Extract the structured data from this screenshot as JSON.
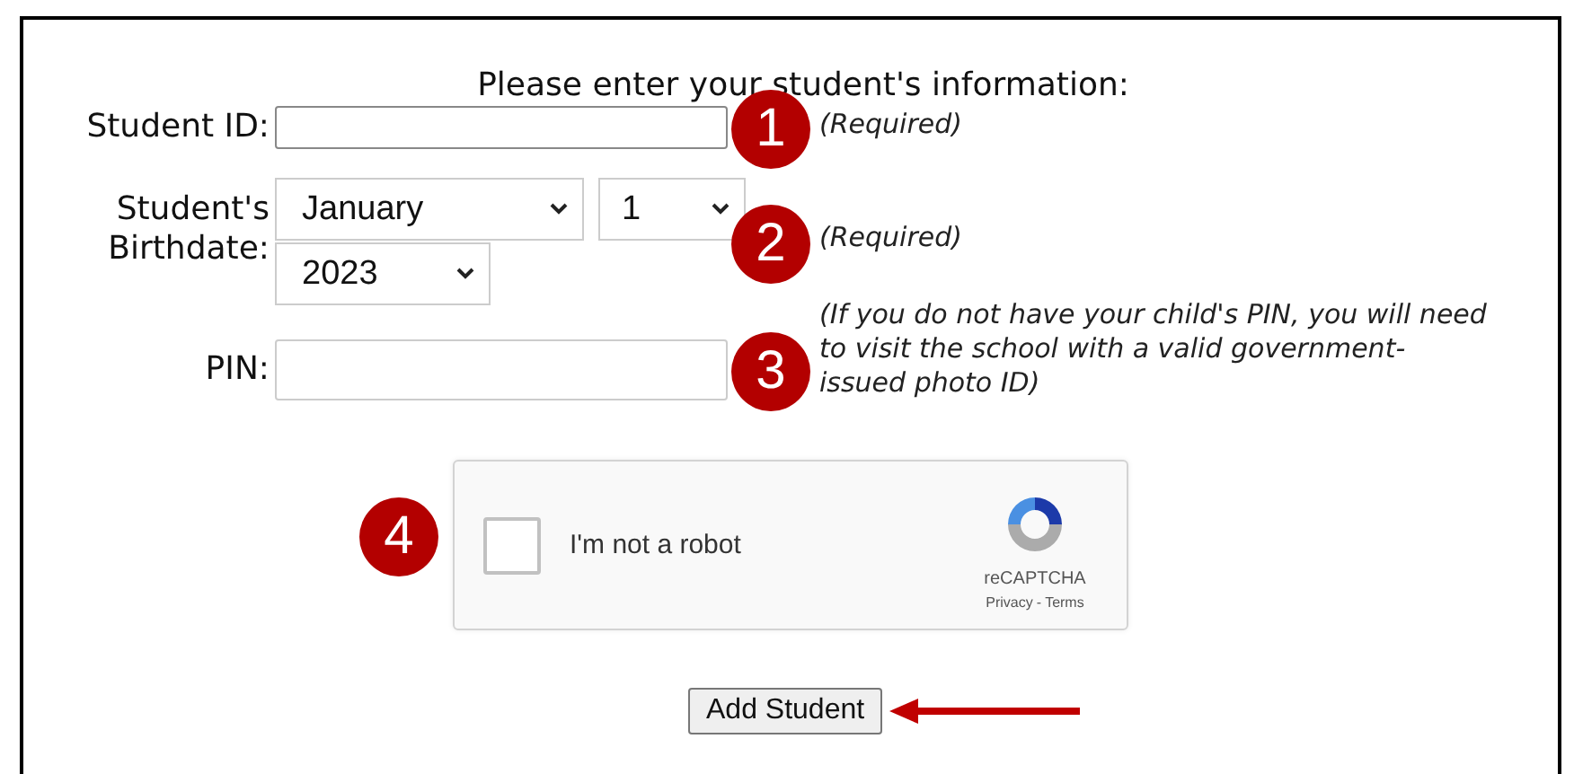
{
  "heading": "Please enter your student's information:",
  "fields": [
    {
      "kind": "text",
      "label": "Student ID:",
      "callout": "1",
      "note": "(Required)"
    },
    {
      "kind": "date",
      "label": "Student's Birthdate:",
      "selects": [
        "January",
        "1",
        "2023"
      ],
      "callout": "2",
      "note": "(Required)"
    },
    {
      "kind": "text",
      "label": "PIN:",
      "callout": "3",
      "note": "(If you do not have your child's PIN, you will need to visit the school with a valid government-issued photo ID)"
    }
  ],
  "captcha": {
    "callout": "4",
    "checked": false,
    "label": "I'm not a robot",
    "brand": "reCAPTCHA",
    "links": [
      "Privacy",
      "Terms"
    ],
    "separator": "-"
  },
  "submit": "Add Student"
}
